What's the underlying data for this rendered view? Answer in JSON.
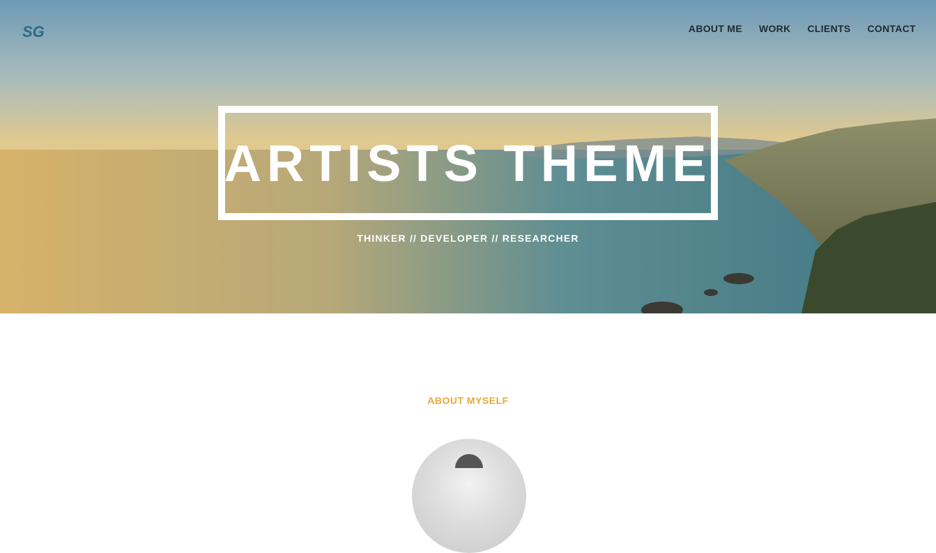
{
  "header": {
    "logo_text": "SG",
    "nav": [
      {
        "label": "ABOUT ME"
      },
      {
        "label": "WORK"
      },
      {
        "label": "CLIENTS"
      },
      {
        "label": "CONTACT"
      }
    ]
  },
  "hero": {
    "title": "ARTISTS THEME",
    "subtitle": "THINKER // DEVELOPER // RESEARCHER"
  },
  "about": {
    "label": "ABOUT MYSELF"
  },
  "colors": {
    "accent": "#e7aa35",
    "logo": "#2a6c86",
    "nav_text": "#1f2a30"
  }
}
